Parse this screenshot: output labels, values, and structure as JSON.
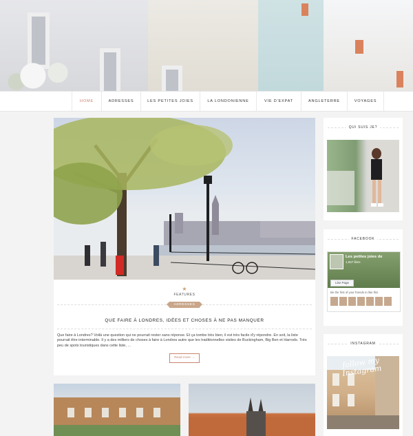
{
  "nav": {
    "items": [
      {
        "label": "HOME",
        "active": true
      },
      {
        "label": "ADRESSES",
        "active": false
      },
      {
        "label": "LES PETITES JOIES",
        "active": false
      },
      {
        "label": "LA LONDONIENNE",
        "active": false
      },
      {
        "label": "VIE D'EXPAT",
        "active": false
      },
      {
        "label": "ANGLETERRE",
        "active": false
      },
      {
        "label": "VOYAGES",
        "active": false
      }
    ]
  },
  "post": {
    "category": "FEATURES",
    "tag": "ADRESSES",
    "title": "QUE FAIRE À LONDRES, IDÉES ET CHOSES À NE PAS MANQUER",
    "excerpt": "Que faire à Londres? Voilà une question qui ne pourrait rester sans réponse. Et ça tombe très bien, il est très facile d'y répondre. En soit, la liste pourrait être interminable. Il y a des milliers de choses à faire à Londres autre que les traditionnelles visites de Buckingham, Big Ben et Harrods. Très peu de spots touristiques dans cette liste, ...",
    "read_more": "Read more →"
  },
  "sidebar": {
    "about_title": "QUI SUIS JE?",
    "facebook_title": "FACEBOOK",
    "facebook": {
      "page_name": "Les petites joies de",
      "likes": "1,557 likes",
      "like_button": "Like Page",
      "friends_text": "Be the first of your friends to like this"
    },
    "instagram_title": "INSTAGRAM",
    "instagram_overlay": "follow my Instagram"
  },
  "colors": {
    "accent": "#c9826f",
    "tag_bg": "#c9a68a"
  }
}
